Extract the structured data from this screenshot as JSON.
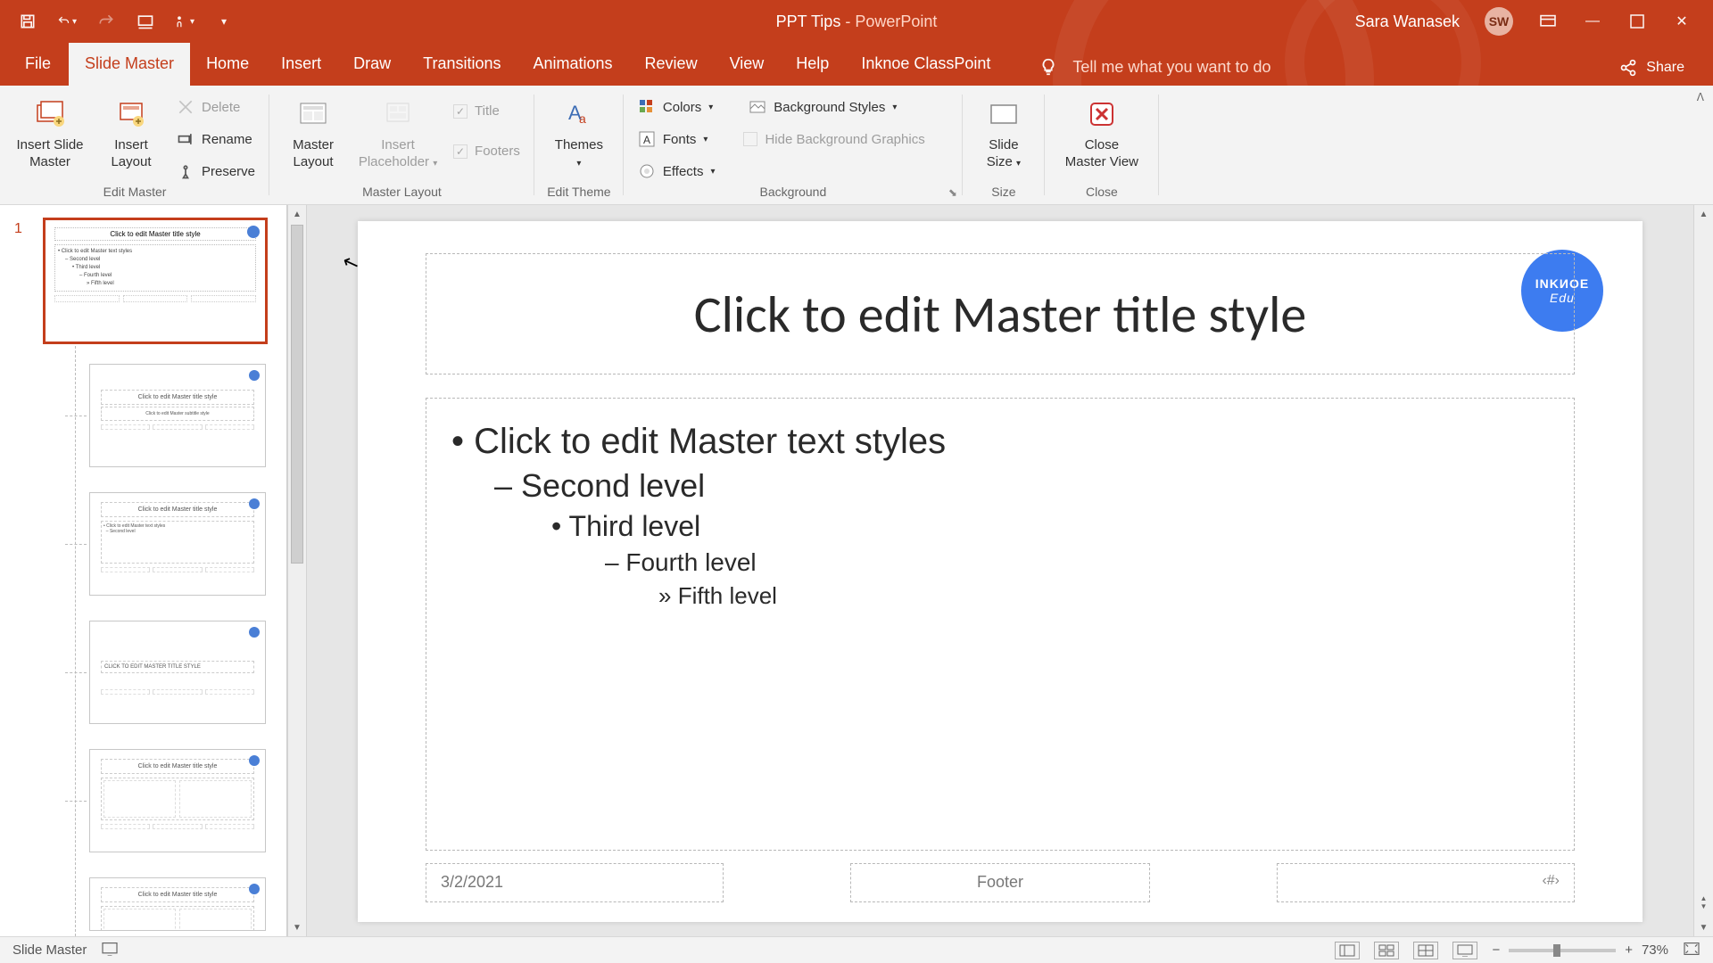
{
  "titlebar": {
    "doc_name": "PPT Tips",
    "app_name": " -  PowerPoint",
    "user_name": "Sara Wanasek",
    "user_initials": "SW"
  },
  "tabs": {
    "file": "File",
    "slide_master": "Slide Master",
    "home": "Home",
    "insert": "Insert",
    "draw": "Draw",
    "transitions": "Transitions",
    "animations": "Animations",
    "review": "Review",
    "view": "View",
    "help": "Help",
    "inknoe": "Inknoe ClassPoint",
    "tellme_placeholder": "Tell me what you want to do",
    "share": "Share"
  },
  "ribbon": {
    "edit_master": {
      "insert_slide_master": "Insert Slide\nMaster",
      "insert_layout": "Insert\nLayout",
      "delete": "Delete",
      "rename": "Rename",
      "preserve": "Preserve",
      "group_label": "Edit Master"
    },
    "master_layout": {
      "master_layout": "Master\nLayout",
      "insert_placeholder": "Insert\nPlaceholder",
      "title_chk": "Title",
      "footers_chk": "Footers",
      "group_label": "Master Layout"
    },
    "edit_theme": {
      "themes": "Themes",
      "group_label": "Edit Theme"
    },
    "background": {
      "colors": "Colors",
      "fonts": "Fonts",
      "effects": "Effects",
      "bg_styles": "Background Styles",
      "hide_bg": "Hide Background Graphics",
      "group_label": "Background"
    },
    "size": {
      "slide_size": "Slide\nSize",
      "group_label": "Size"
    },
    "close": {
      "close_master": "Close\nMaster View",
      "group_label": "Close"
    }
  },
  "thumbs": {
    "number": "1",
    "master_title": "Click to edit Master title style",
    "layout_title": "Click to edit Master title style",
    "section_title": "CLICK TO EDIT MASTER TITLE STYLE",
    "body_preview": "• Click to edit Master text styles"
  },
  "slide": {
    "title": "Click to edit Master title style",
    "l1": "Click to edit Master text styles",
    "l2": "Second level",
    "l3": "Third level",
    "l4": "Fourth level",
    "l5": "Fifth level",
    "date": "3/2/2021",
    "footer": "Footer",
    "num": "‹#›",
    "inknoe_top": "INKИOE",
    "inknoe_sub": "Edu"
  },
  "status": {
    "mode": "Slide Master",
    "zoom": "73%"
  }
}
